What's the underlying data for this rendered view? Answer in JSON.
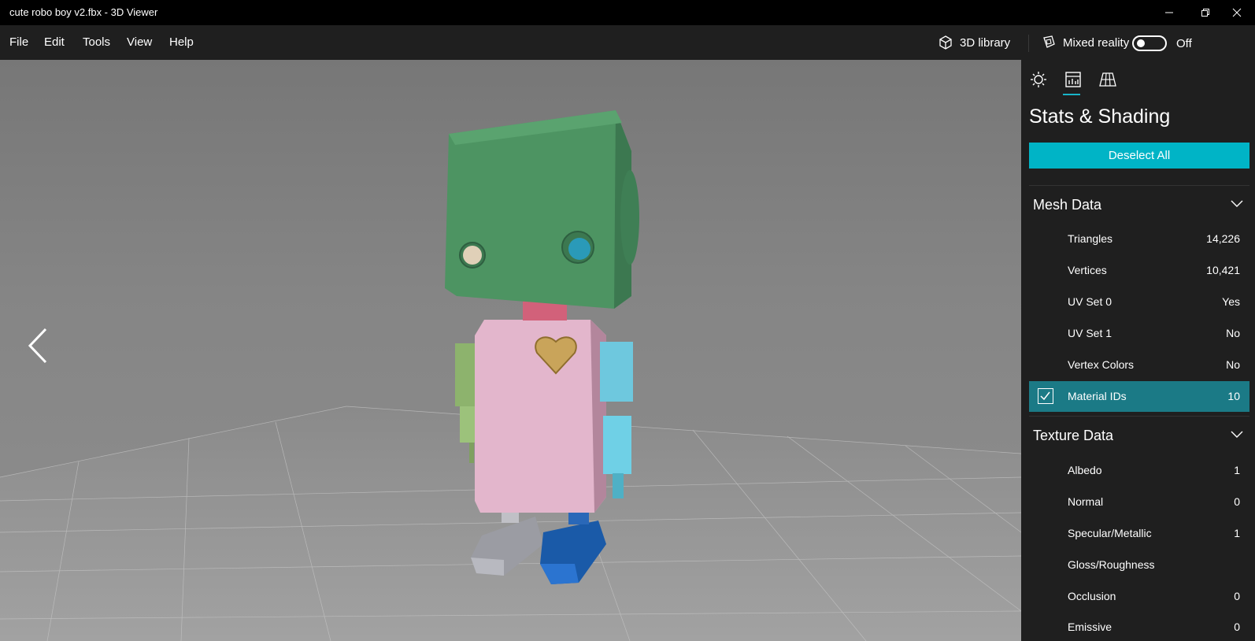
{
  "window": {
    "title": "cute robo boy v2.fbx - 3D Viewer"
  },
  "menu": {
    "items": [
      "File",
      "Edit",
      "Tools",
      "View",
      "Help"
    ]
  },
  "toolbar": {
    "library_label": "3D library",
    "mixed_reality_label": "Mixed reality",
    "mixed_reality_state": "Off"
  },
  "panel": {
    "tabs": [
      "lighting-icon",
      "stats-icon",
      "grid-icon"
    ],
    "active_tab": 1,
    "title": "Stats & Shading",
    "deselect_label": "Deselect All",
    "mesh": {
      "header": "Mesh Data",
      "rows": [
        {
          "label": "Triangles",
          "value": "14,226"
        },
        {
          "label": "Vertices",
          "value": "10,421"
        },
        {
          "label": "UV Set 0",
          "value": "Yes"
        },
        {
          "label": "UV Set 1",
          "value": "No"
        },
        {
          "label": "Vertex Colors",
          "value": "No"
        },
        {
          "label": "Material IDs",
          "value": "10",
          "checked": true
        }
      ]
    },
    "texture": {
      "header": "Texture Data",
      "rows": [
        {
          "label": "Albedo",
          "value": "1"
        },
        {
          "label": "Normal",
          "value": "0"
        },
        {
          "label": "Specular/Metallic",
          "value": "1"
        },
        {
          "label": "Gloss/Roughness",
          "value": ""
        },
        {
          "label": "Occlusion",
          "value": "0"
        },
        {
          "label": "Emissive",
          "value": "0"
        }
      ]
    }
  },
  "colors": {
    "accent": "#00b4c6",
    "selected_row": "#1b7a86"
  }
}
